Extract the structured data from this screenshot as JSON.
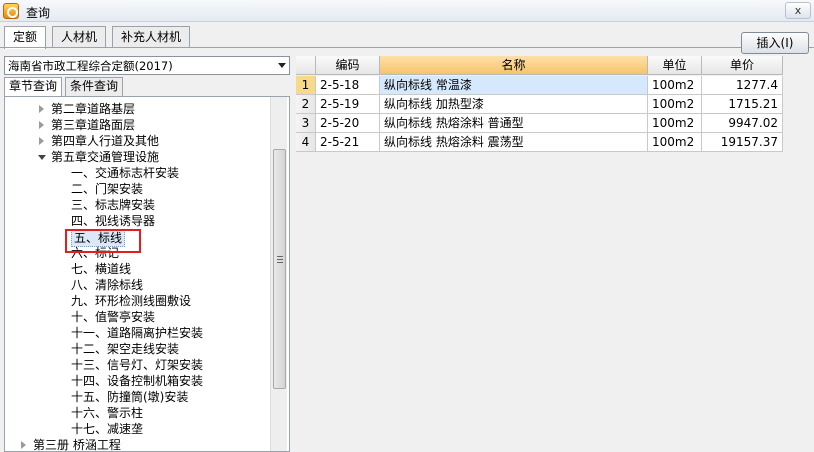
{
  "window": {
    "title": "查询",
    "close_label": "x"
  },
  "top_tabs": [
    "定额",
    "人材机",
    "补充人材机"
  ],
  "insert_button": "插入(I)",
  "library_select": "海南省市政工程综合定额(2017)",
  "sub_tabs": [
    "章节查询",
    "条件查询"
  ],
  "tree": {
    "items": [
      {
        "label": "第二章道路基层",
        "state": "collapsed"
      },
      {
        "label": "第三章道路面层",
        "state": "collapsed"
      },
      {
        "label": "第四章人行道及其他",
        "state": "collapsed"
      },
      {
        "label": "第五章交通管理设施",
        "state": "expanded"
      },
      {
        "label": "一、交通标志杆安装",
        "state": "leaf"
      },
      {
        "label": "二、门架安装",
        "state": "leaf"
      },
      {
        "label": "三、标志牌安装",
        "state": "leaf"
      },
      {
        "label": "四、视线诱导器",
        "state": "leaf"
      },
      {
        "label": "五、标线",
        "state": "selected"
      },
      {
        "label": "六、标记",
        "state": "leaf"
      },
      {
        "label": "七、横道线",
        "state": "leaf"
      },
      {
        "label": "八、清除标线",
        "state": "leaf"
      },
      {
        "label": "九、环形检测线圈敷设",
        "state": "leaf"
      },
      {
        "label": "十、值警亭安装",
        "state": "leaf"
      },
      {
        "label": "十一、道路隔离护栏安装",
        "state": "leaf"
      },
      {
        "label": "十二、架空走线安装",
        "state": "leaf"
      },
      {
        "label": "十三、信号灯、灯架安装",
        "state": "leaf"
      },
      {
        "label": "十四、设备控制机箱安装",
        "state": "leaf"
      },
      {
        "label": "十五、防撞筒(墩)安装",
        "state": "leaf"
      },
      {
        "label": "十六、警示柱",
        "state": "leaf"
      },
      {
        "label": "十七、减速垄",
        "state": "leaf"
      },
      {
        "label": "第三册 桥涵工程",
        "state": "collapsed"
      }
    ]
  },
  "grid": {
    "columns": [
      "编码",
      "名称",
      "单位",
      "单价"
    ],
    "rows": [
      {
        "n": "1",
        "code": "2-5-18",
        "name": "纵向标线 常温漆",
        "unit": "100m2",
        "price": "1277.4"
      },
      {
        "n": "2",
        "code": "2-5-19",
        "name": "纵向标线 加热型漆",
        "unit": "100m2",
        "price": "1715.21"
      },
      {
        "n": "3",
        "code": "2-5-20",
        "name": "纵向标线 热熔涂料 普通型",
        "unit": "100m2",
        "price": "9947.02"
      },
      {
        "n": "4",
        "code": "2-5-21",
        "name": "纵向标线 热熔涂料 震荡型",
        "unit": "100m2",
        "price": "19157.37"
      }
    ]
  }
}
